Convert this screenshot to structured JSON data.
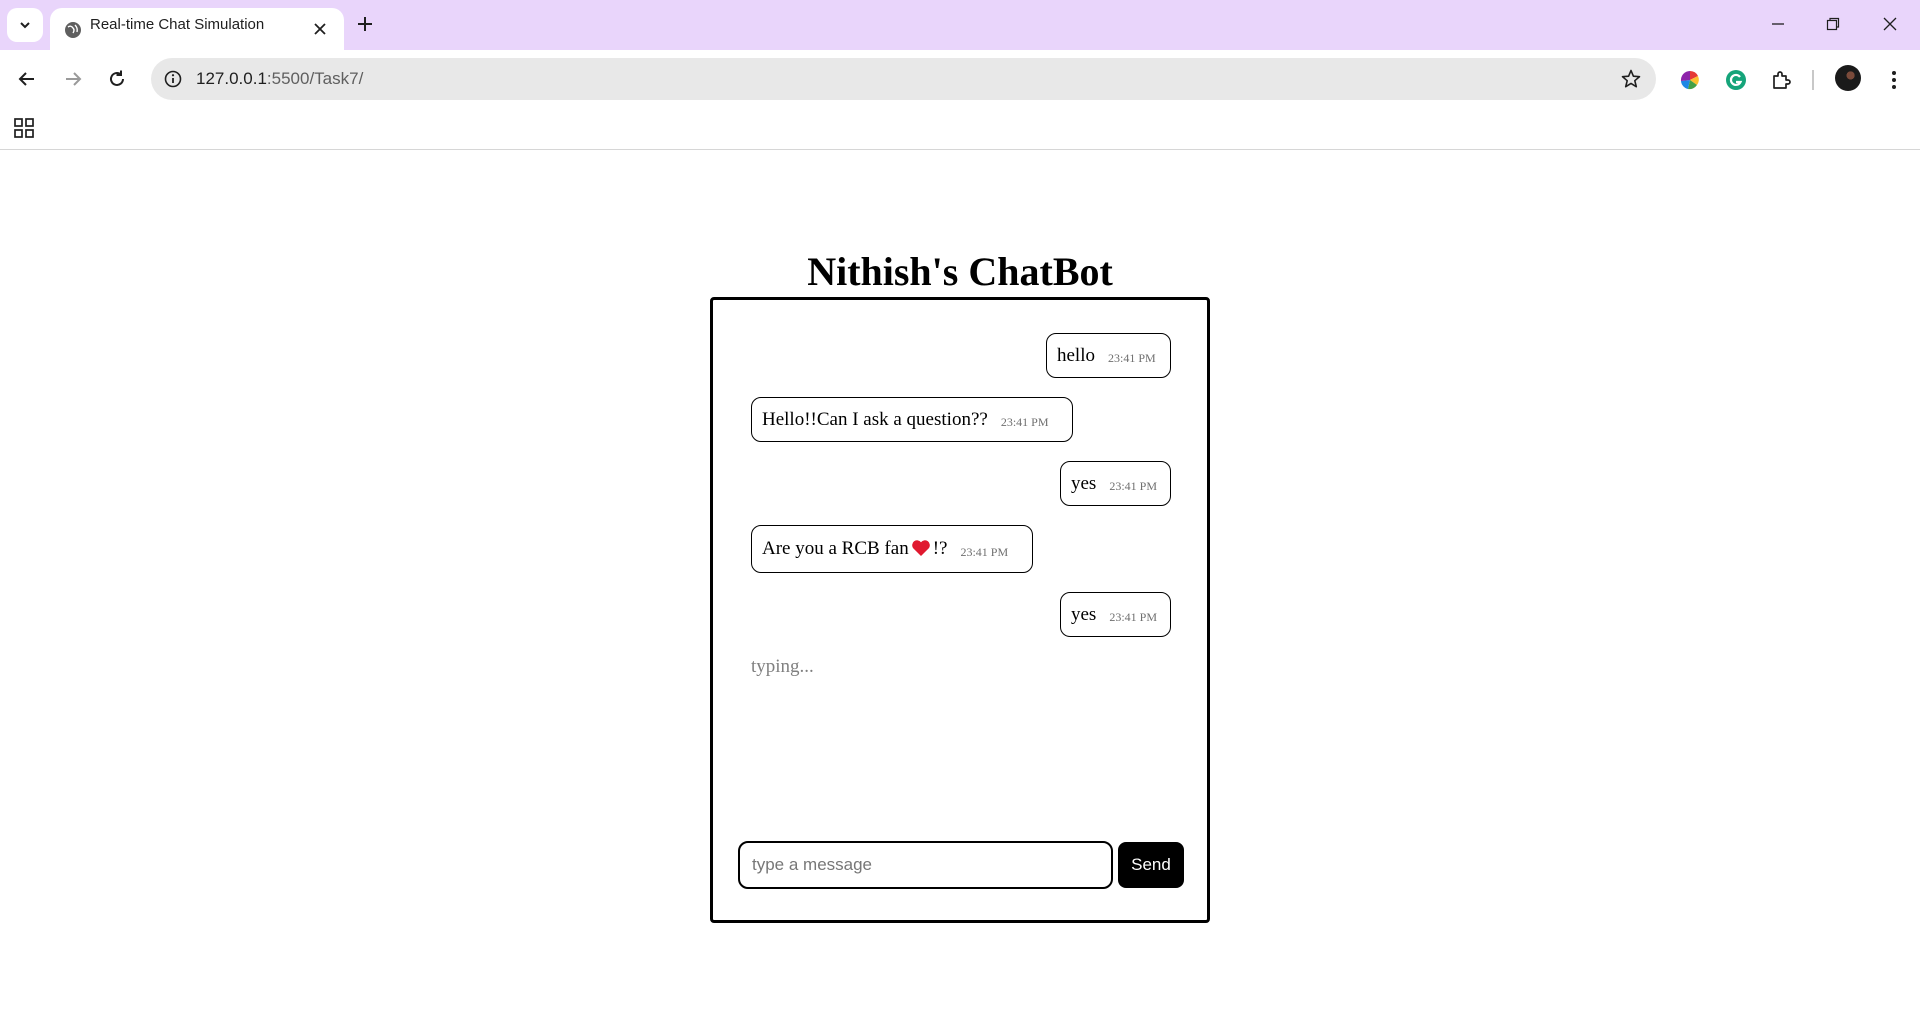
{
  "browser": {
    "tab_title": "Real-time Chat Simulation",
    "url_host": "127.0.0.1",
    "url_rest": ":5500/Task7/"
  },
  "page": {
    "title": "Nithish's ChatBot"
  },
  "chat": {
    "messages": [
      {
        "sender": "user",
        "text": "hello",
        "time": "23:41 PM"
      },
      {
        "sender": "bot",
        "text": "Hello!!Can I ask a question??",
        "time": "23:41 PM"
      },
      {
        "sender": "user",
        "text": "yes",
        "time": "23:41 PM"
      },
      {
        "sender": "bot",
        "text_before": "Are you a RCB fan",
        "emoji": "heart",
        "text_after": "!?",
        "time": "23:41 PM"
      },
      {
        "sender": "user",
        "text": "yes",
        "time": "23:41 PM"
      }
    ],
    "typing_indicator": "typing...",
    "input_placeholder": "type a message",
    "input_value": "",
    "send_label": "Send"
  },
  "colors": {
    "tabstrip": "#e9d5fb",
    "omnibox": "#e8e8e8",
    "heart": "#e0192f"
  }
}
